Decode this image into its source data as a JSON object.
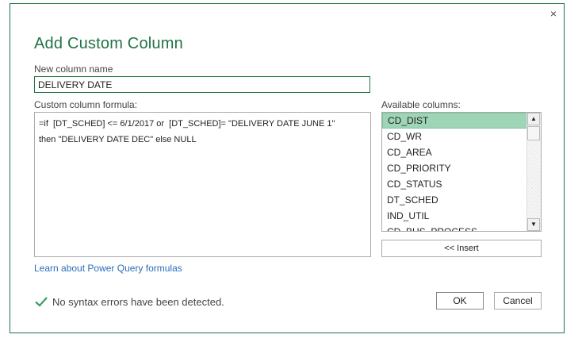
{
  "dialog": {
    "title": "Add Custom Column",
    "close_glyph": "×",
    "name_label": "New column name",
    "name_value": "DELIVERY DATE",
    "formula_label": "Custom column formula:",
    "formula_lines": [
      "=if  [DT_SCHED] <= 6/1/2017 or  [DT_SCHED]= \"DELIVERY DATE JUNE 1\"",
      "then \"DELIVERY DATE DEC\" else NULL"
    ],
    "columns_label": "Available columns:",
    "columns": [
      "CD_DIST",
      "CD_WR",
      "CD_AREA",
      "CD_PRIORITY",
      "CD_STATUS",
      "DT_SCHED",
      "IND_UTIL",
      "CD_BUS_PROCESS"
    ],
    "insert_label": "<< Insert",
    "learn_link": "Learn about Power Query formulas",
    "status_text": "No syntax errors have been detected.",
    "ok_label": "OK",
    "cancel_label": "Cancel",
    "accent_color": "#217346",
    "selected_color": "#9fd5b7",
    "icons": {
      "close": "close-icon",
      "check": "check-icon",
      "scroll_up": "arrow-up-icon",
      "scroll_down": "arrow-down-icon"
    }
  }
}
